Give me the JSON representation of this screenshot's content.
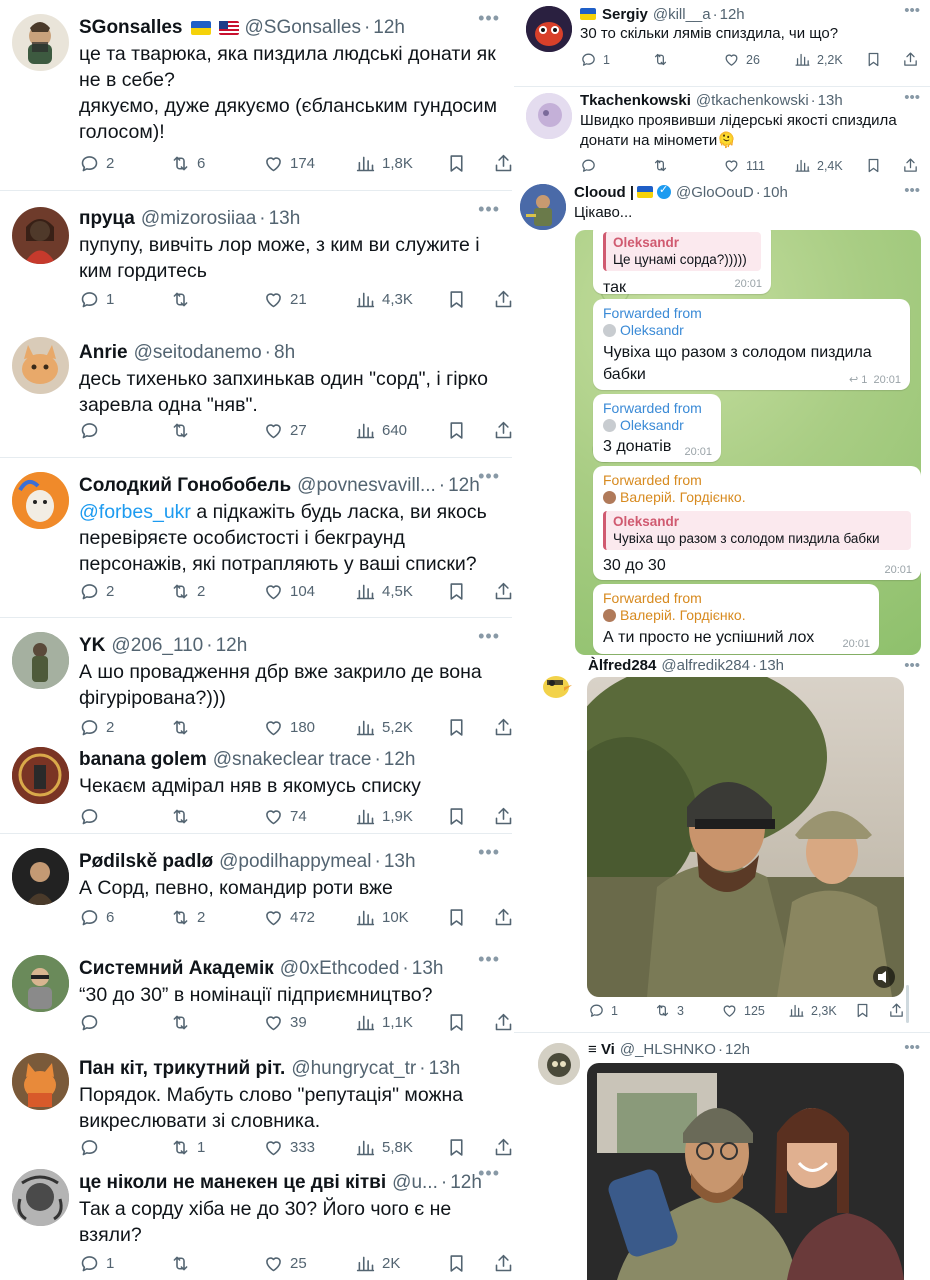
{
  "left_tweets": [
    {
      "name": "SGonsalles",
      "flags": [
        "ua",
        "us"
      ],
      "handle": "@SGonsalles",
      "time": "12h",
      "lines": [
        "це та тварюка, яка пиздила людські донати як",
        "не в себе?",
        "дякуємо, дуже дякуємо (єбланським гундосим",
        "голосом)!"
      ],
      "replies": "2",
      "retweets": "6",
      "likes": "174",
      "views": "1,8K"
    },
    {
      "name": "пруца",
      "handle": "@mizorosiiaa",
      "time": "13h",
      "lines": [
        "пупупу, вивчіть лор може, з ким ви служите і",
        "ким гордитесь"
      ],
      "replies": "1",
      "retweets": "",
      "likes": "21",
      "views": "4,3K"
    },
    {
      "name": "Anrie",
      "handle": "@seitodanemo",
      "time": "8h",
      "lines": [
        "десь тихенько запхинькав один \"сорд\", і гірко",
        "заревла одна \"няв\"."
      ],
      "replies": "",
      "retweets": "",
      "likes": "27",
      "views": "640"
    },
    {
      "name": "Солодкий Гонобобель",
      "handle": "@povnesvavill...",
      "time": "12h",
      "mention": "@forbes_ukr",
      "lines": [
        " а підкажіть будь ласка, ви якось",
        "перевіряєте особистості і бекграунд",
        "персонажів, які потрапляють у ваші списки?"
      ],
      "replies": "2",
      "retweets": "2",
      "likes": "104",
      "views": "4,5K"
    },
    {
      "name": "YK",
      "handle": "@206_110",
      "time": "12h",
      "lines": [
        "А шо провадження дбр вже закрило де вона",
        "фігурірована?)))"
      ],
      "replies": "2",
      "retweets": "",
      "likes": "180",
      "views": "5,2K"
    },
    {
      "name": "banana golem",
      "handle": "@snakeclear trace",
      "time": "12h",
      "lines": [
        "Чекаєм адмірал няв в якомусь списку"
      ],
      "replies": "",
      "retweets": "",
      "likes": "74",
      "views": "1,9K"
    },
    {
      "name": "Pødilskě padlø",
      "handle": "@podilhappymeal",
      "time": "13h",
      "lines": [
        "А Сорд, певно, командир роти вже"
      ],
      "replies": "6",
      "retweets": "2",
      "likes": "472",
      "views": "10K"
    },
    {
      "name": "Системний Академік",
      "handle": "@0xEthcoded",
      "time": "13h",
      "lines": [
        "“30 до 30” в номінації підприємництво?"
      ],
      "replies": "",
      "retweets": "",
      "likes": "39",
      "views": "1,1K"
    },
    {
      "name": "Пан кіт, трикутний ріт.",
      "handle": "@hungrycat_tr",
      "time": "13h",
      "lines": [
        "Порядок. Мабуть слово \"репутація\" можна",
        "викреслювати зі словника."
      ],
      "replies": "",
      "retweets": "1",
      "likes": "333",
      "views": "5,8K"
    },
    {
      "name": "це ніколи не манекен це дві кітві",
      "handle": "@u...",
      "time": "12h",
      "lines": [
        "Так а сорду хіба не до 30? Його чого є не",
        "взяли?"
      ],
      "replies": "1",
      "retweets": "",
      "likes": "25",
      "views": "2K"
    }
  ],
  "right_tweets": {
    "sergiy": {
      "name": "Sergiy",
      "flag": "ua",
      "handle": "@kill__a",
      "time": "12h",
      "text": "30 то скільки лямів спиздила, чи що?",
      "replies": "1",
      "retweets": "",
      "likes": "26",
      "views": "2,2K"
    },
    "tkach": {
      "name": "Tkachenkowski",
      "handle": "@tkachenkowski",
      "time": "13h",
      "lines": [
        "Швидко проявивши лідерські якості спиздила",
        "донати на міномети"
      ],
      "emoji": "🫠",
      "replies": "",
      "retweets": "",
      "likes": "111",
      "views": "2,4K"
    },
    "cloud": {
      "name": "Clooud |",
      "flag": "ua",
      "handle": "@GloOouD",
      "time": "10h",
      "text": "Цікаво..."
    },
    "alfred": {
      "name": "Àlfred284",
      "handle": "@alfredik284",
      "time": "13h",
      "replies": "1",
      "retweets": "3",
      "likes": "125",
      "views": "2,3K"
    },
    "vi": {
      "name": "Vi",
      "prefix": "≡",
      "handle": "@_HLSHNKO",
      "time": "12h"
    }
  },
  "telegram": {
    "m1": {
      "quote_name": "Oleksandr",
      "quote_text": "Це цунамі сорда?)))))",
      "text": "так",
      "time": "20:01"
    },
    "m2": {
      "forwarded": "Forwarded from",
      "from": "Oleksandr",
      "lines": [
        "Чувіха що разом з солодом пиздила",
        "бабки"
      ],
      "reply_count": "1",
      "time": "20:01"
    },
    "m3": {
      "forwarded": "Forwarded from",
      "from": "Oleksandr",
      "text": "3 донатів",
      "time": "20:01"
    },
    "m4": {
      "forwarded": "Forwarded from",
      "from": "Валерій. Гордієнко.",
      "quote_name": "Oleksandr",
      "quote_text": "Чувіха що разом з солодом пиздила бабки",
      "text": "30 до 30",
      "time": "20:01"
    },
    "m5": {
      "forwarded": "Forwarded from",
      "from": "Валерій. Гордієнко.",
      "text": "А ти просто не успішний лох",
      "time": "20:01"
    }
  },
  "colors": {
    "accent": "#1d9bf0",
    "muted": "#536471",
    "telegram_link": "#3a8ad6",
    "telegram_orange": "#d78a1f",
    "quote_red": "#d05a70"
  }
}
